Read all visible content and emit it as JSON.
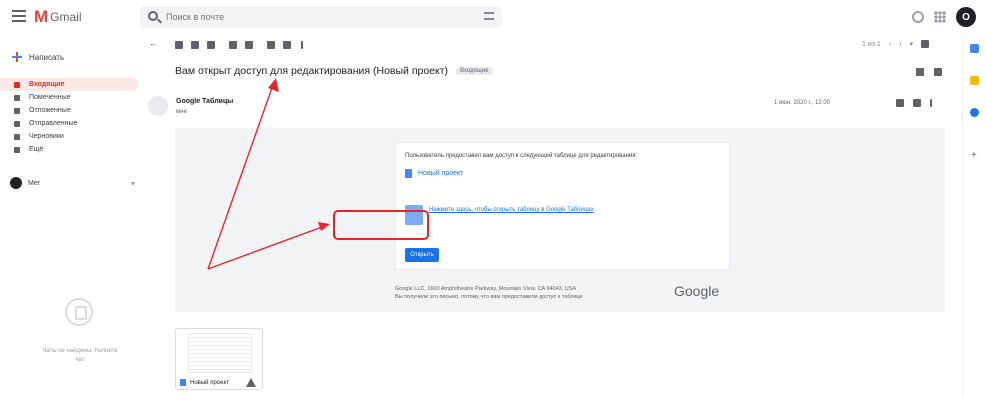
{
  "brand": {
    "logo_letter": "M",
    "name": "Gmail"
  },
  "search": {
    "placeholder": "Поиск в почте"
  },
  "user": {
    "initial": "О"
  },
  "nav": {
    "compose_label": "Написать",
    "items": [
      {
        "label": "Входящие",
        "active": true
      },
      {
        "label": "Помеченные",
        "active": false
      },
      {
        "label": "Отложенные",
        "active": false
      },
      {
        "label": "Отправленные",
        "active": false
      },
      {
        "label": "Черновики",
        "active": false
      },
      {
        "label": "Ещё",
        "active": false
      }
    ],
    "user_name": "Мег",
    "hangouts_text": "Чаты не найдены. Начните чат"
  },
  "toolbar": {
    "pager_text": "1 из 1"
  },
  "message": {
    "subject": "Вам открыт доступ для редактирования (Новый проект)",
    "tag": "Входящие",
    "sender": "Google Таблицы",
    "to": "мне",
    "date": "1 июн. 2020 г., 12:00"
  },
  "card": {
    "intro": "Пользователь предоставил вам доступ к следующей таблице для редактирования:",
    "file_name": "Новый проект",
    "link_text": "Нажмите здесь, чтобы открыть таблицу в Google Таблицах",
    "button_label": "Открыть"
  },
  "footer": {
    "line1": "Google LLC, 1600 Amphitheatre Parkway, Mountain View, CA 94043, USA",
    "line2": "Вы получили это письмо, потому что вам предоставили доступ к таблице",
    "google_logo": "Google"
  },
  "attachment": {
    "name": "Новый проект"
  },
  "colors": {
    "annotation": "#e8242a",
    "brand_red": "#ea4335",
    "link_blue": "#1a73e8"
  }
}
